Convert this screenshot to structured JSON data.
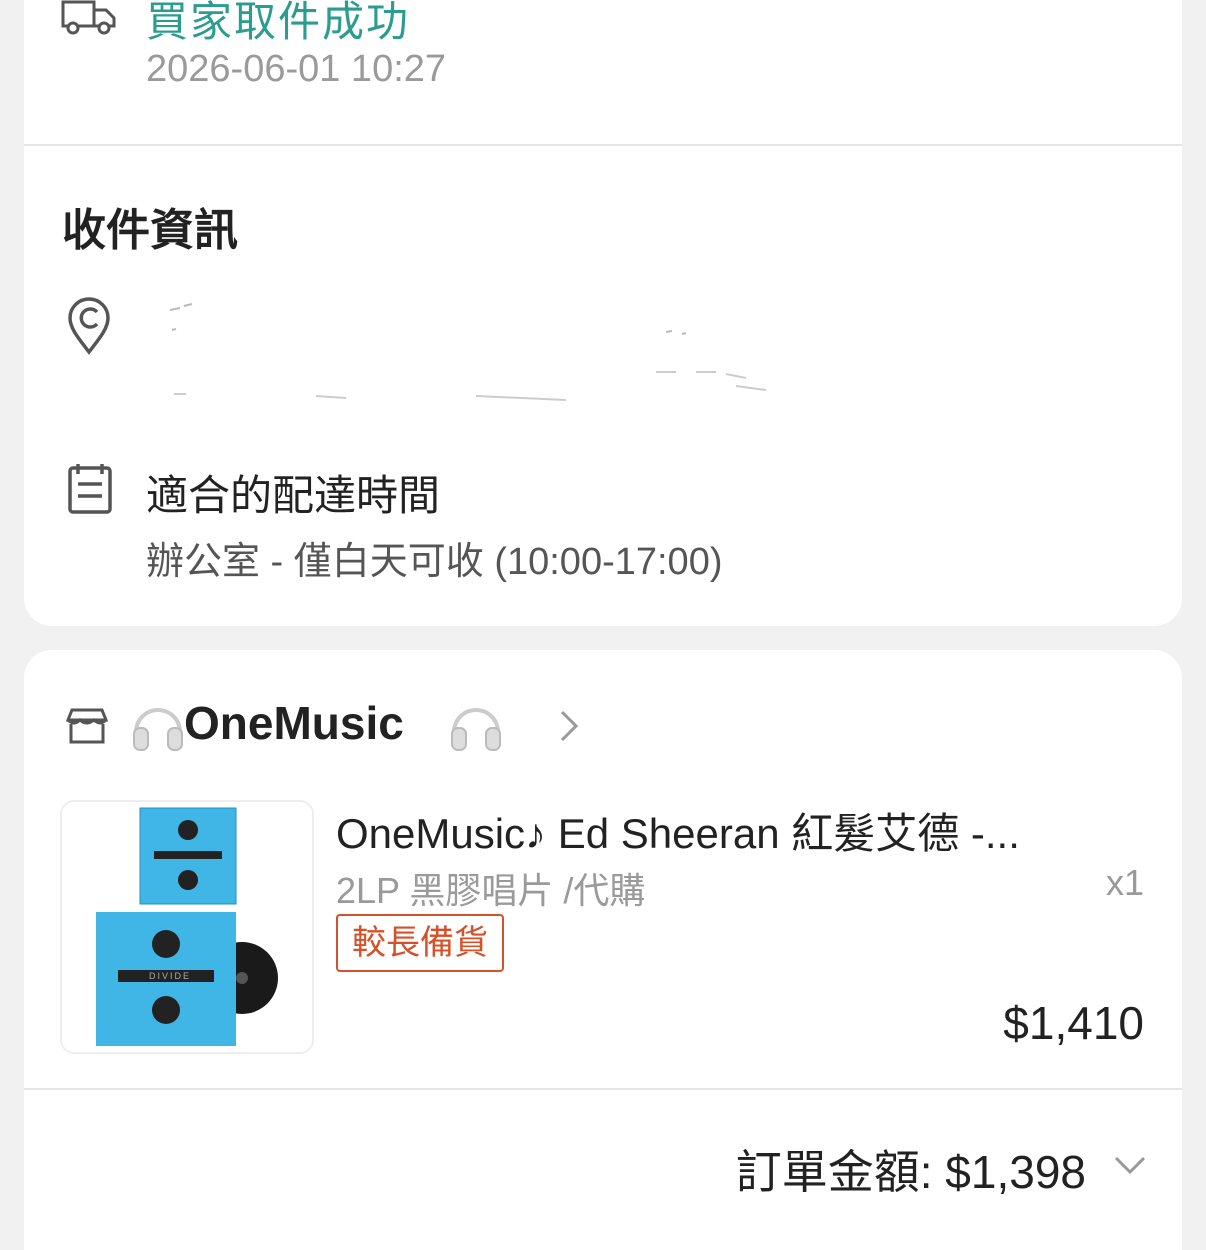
{
  "shipping_status": {
    "title": "買家取件成功",
    "timestamp": "2026-06-01 10:27",
    "icon": "truck-icon"
  },
  "recipient": {
    "section_title": "收件資訊",
    "address_icon": "location-pin-icon",
    "delivery_time_icon": "calendar-icon",
    "delivery_time_label": "適合的配達時間",
    "delivery_time_value": "辦公室 - 僅白天可收 (10:00-17:00)"
  },
  "shop": {
    "icon": "store-icon",
    "name": "OneMusic",
    "decor_icon": "headphones-icon",
    "chevron": "chevron-right-icon"
  },
  "product": {
    "title": "OneMusic♪ Ed Sheeran 紅髮艾德 -...",
    "variant": "2LP 黑膠唱片 /代購",
    "quantity": "x1",
    "badge": "較長備貨",
    "price": "$1,410",
    "image_text": "DIVIDE"
  },
  "order": {
    "total_label": "訂單金額: $1,398",
    "expand_icon": "chevron-down-icon"
  },
  "colors": {
    "status_green": "#2a9d8f",
    "badge_orange": "#d4512a",
    "album_blue": "#3fb6e6"
  }
}
